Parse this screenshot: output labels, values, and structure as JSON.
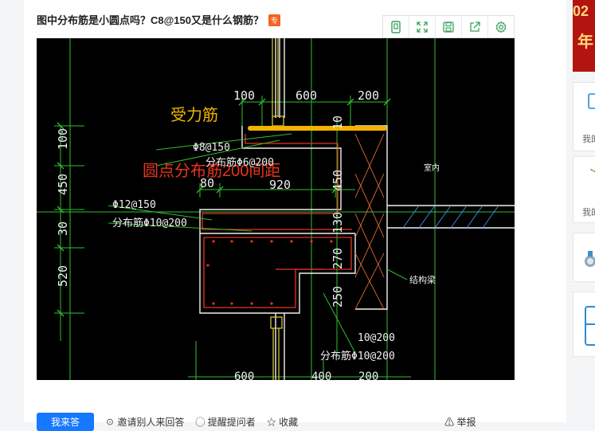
{
  "post": {
    "title": "图中分布筋是小圆点吗？C8@150又是什么钢筋？",
    "tag": "专"
  },
  "toolbar": {
    "icons": [
      "copy-icon",
      "fullscreen-icon",
      "save-icon",
      "share-icon",
      "settings-icon"
    ]
  },
  "drawing": {
    "annotations": {
      "main_bar": "受力筋",
      "dist_note": "圆点分布筋200间距"
    },
    "dims_top": [
      "100",
      "600",
      "200"
    ],
    "dims_left": [
      "100",
      "450",
      "30",
      "520"
    ],
    "dims_mid": [
      "10",
      "450",
      "130",
      "270",
      "250"
    ],
    "dim_80": "80",
    "dim_920": "920",
    "phi8_150": "Φ8@150",
    "dist_phi6": "分布筋Φ6@200",
    "phi12_150": "Φ12@150",
    "dist_phi10": "分布筋Φ10@200",
    "indoor": "室内",
    "struct_beam": "结构梁",
    "bar_10_200": "10@200",
    "dist_phi10_b": "分布筋Φ10@200",
    "dims_bottom": [
      "600",
      "400",
      "200"
    ]
  },
  "actions": {
    "primary": "我来答",
    "invite": "邀请别人来回答",
    "remind": "提醒提问者",
    "favorite": "收藏",
    "report": "举报"
  },
  "sidebar": {
    "banner_text": "02",
    "banner_text2": "年",
    "card1_text": "我的",
    "card2_text": "我的"
  },
  "colors": {
    "accent": "#1677ff",
    "main_bar": "#f2b300",
    "annotation_red": "#e8341c",
    "cad_green": "#2fbf2f"
  }
}
